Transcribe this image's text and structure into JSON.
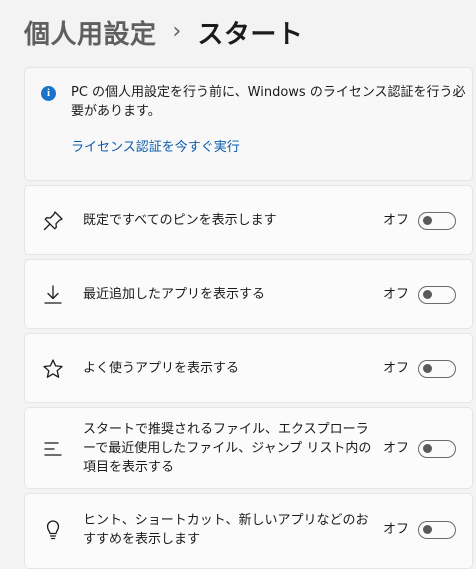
{
  "header": {
    "parent": "個人用設定",
    "separator": "›",
    "current": "スタート"
  },
  "notice": {
    "icon": "info-icon",
    "icon_glyph": "i",
    "accent_color": "#1a73c8",
    "text": "PC の個人用設定を行う前に、Windows のライセンス認証を行う必要があります。",
    "link_label": "ライセンス認証を今すぐ実行",
    "link_color": "#0b5cad"
  },
  "settings": [
    {
      "icon": "pin-icon",
      "label": "既定ですべてのピンを表示します",
      "state": "オフ",
      "enabled": false
    },
    {
      "icon": "download-icon",
      "label": "最近追加したアプリを表示する",
      "state": "オフ",
      "enabled": false
    },
    {
      "icon": "star-icon",
      "label": "よく使うアプリを表示する",
      "state": "オフ",
      "enabled": false
    },
    {
      "icon": "list-icon",
      "label": "スタートで推奨されるファイル、エクスプローラーで最近使用したファイル、ジャンプ リスト内の項目を表示する",
      "state": "オフ",
      "enabled": false
    },
    {
      "icon": "lightbulb-icon",
      "label": "ヒント、ショートカット、新しいアプリなどのおすすめを表示します",
      "state": "オフ",
      "enabled": false
    }
  ]
}
